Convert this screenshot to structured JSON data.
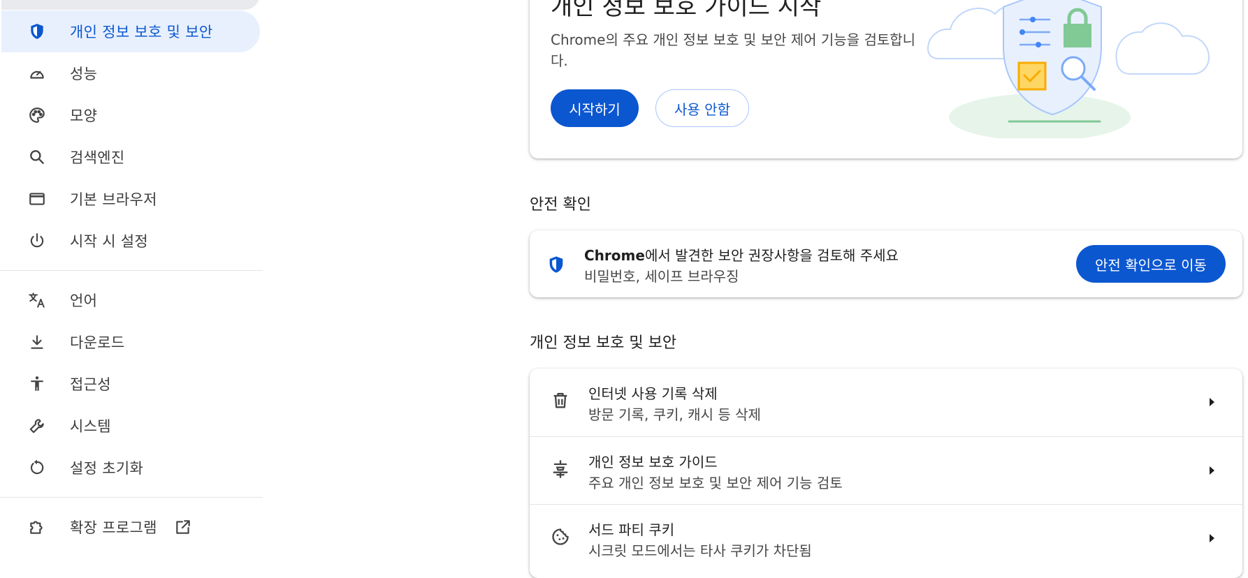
{
  "sidebar": {
    "items": [
      {
        "label": "개인 정보 보호 및 보안",
        "icon": "shield-icon",
        "active": true
      },
      {
        "label": "성능",
        "icon": "speedometer-icon"
      },
      {
        "label": "모양",
        "icon": "palette-icon"
      },
      {
        "label": "검색엔진",
        "icon": "search-icon"
      },
      {
        "label": "기본 브라우저",
        "icon": "browser-window-icon"
      },
      {
        "label": "시작 시 설정",
        "icon": "power-icon"
      },
      {
        "label": "언어",
        "icon": "translate-icon"
      },
      {
        "label": "다운로드",
        "icon": "download-icon"
      },
      {
        "label": "접근성",
        "icon": "accessibility-icon"
      },
      {
        "label": "시스템",
        "icon": "wrench-icon"
      },
      {
        "label": "설정 초기화",
        "icon": "reset-icon"
      },
      {
        "label": "확장 프로그램",
        "icon": "extension-icon",
        "external": true
      }
    ]
  },
  "guide": {
    "title": "개인 정보 보호 가이드 시작",
    "description": "Chrome의 주요 개인 정보 보호 및 보안 제어 기능을 검토합니다.",
    "start_label": "시작하기",
    "no_thanks_label": "사용 안함"
  },
  "safety": {
    "section_title": "안전 확인",
    "text_brand": "Chrome",
    "text_rest": "에서 발견한 보안 권장사항을 검토해 주세요",
    "subtext": "비밀번호, 세이프 브라우징",
    "button_label": "안전 확인으로 이동"
  },
  "privacy": {
    "section_title": "개인 정보 보호 및 보안",
    "rows": [
      {
        "title": "인터넷 사용 기록 삭제",
        "subtitle": "방문 기록, 쿠키, 캐시 등 삭제",
        "icon": "trash-icon"
      },
      {
        "title": "개인 정보 보호 가이드",
        "subtitle": "주요 개인 정보 보호 및 보안 제어 기능 검토",
        "icon": "privacy-guide-icon"
      },
      {
        "title": "서드 파티 쿠키",
        "subtitle": "시크릿 모드에서는 타사 쿠키가 차단됨",
        "icon": "cookie-icon"
      }
    ]
  },
  "colors": {
    "accent": "#0b57d0",
    "active_bg": "#e8f0fe"
  }
}
